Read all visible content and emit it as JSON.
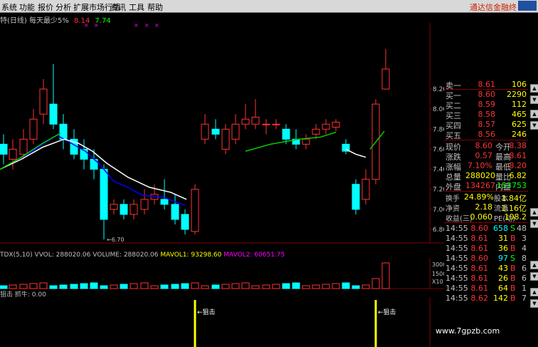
{
  "menu": {
    "items": [
      "系统",
      "功能",
      "报价",
      "分析",
      "扩展市场行情",
      "资讯",
      "工具",
      "帮助"
    ],
    "brand": "通达信金融终"
  },
  "chart": {
    "title_name": "特(日线) 每天最少5%",
    "title_v1": "8.14",
    "title_v2": "7.74",
    "price_ticks": [
      "8.20",
      "8.00",
      "7.80",
      "7.60",
      "7.40",
      "7.20",
      "7.00",
      "6.80"
    ],
    "low_label": "6.70",
    "volume_line": {
      "a": "TDX(5,10)",
      "b": "VVOL: 288020.06",
      "c": "VOLUME: 288020.06",
      "d": "MAVOL1: 93298.60",
      "e": "MAVOL2: 60651.75"
    },
    "volume_ticks": [
      "30000",
      "15000",
      "X10"
    ],
    "indicator_line": {
      "a": "狙击",
      "b": "抓牛: 0.00"
    },
    "signal_label": "狙击",
    "colors": {
      "up": "#ff3333",
      "down": "#00ffff",
      "ma_short": "#0000ff",
      "ma_long": "#ffffff",
      "ma_green": "#00cc00",
      "signal": "#ffff00"
    }
  },
  "quote": {
    "ask": [
      {
        "label": "卖一",
        "price": "8.61",
        "vol": "106"
      }
    ],
    "bid": [
      {
        "label": "买一",
        "price": "8.60",
        "vol": "2290"
      },
      {
        "label": "买二",
        "price": "8.59",
        "vol": "112"
      },
      {
        "label": "买三",
        "price": "8.58",
        "vol": "465"
      },
      {
        "label": "买四",
        "price": "8.57",
        "vol": "625"
      },
      {
        "label": "买五",
        "price": "8.56",
        "vol": "246"
      }
    ],
    "stats": [
      {
        "l1": "现价",
        "v1": "8.60",
        "l2": "今开",
        "v2": "8.38"
      },
      {
        "l1": "涨跌",
        "v1": "0.57",
        "l2": "最高",
        "v2": "8.61"
      },
      {
        "l1": "涨幅",
        "v1": "7.10%",
        "l2": "最低",
        "v2": "8.20"
      },
      {
        "l1": "总量",
        "v1": "288020",
        "l2": "量比",
        "v2": "6.82"
      },
      {
        "l1": "外盘",
        "v1": "134267",
        "l2": "内盘",
        "v2": "153753"
      }
    ],
    "stats2": [
      {
        "l1": "换手",
        "v1": "24.89%",
        "l2": "股本",
        "v2": "1.84亿"
      },
      {
        "l1": "净资",
        "v1": "2.18",
        "l2": "流通",
        "v2": "1.16亿"
      },
      {
        "l1": "收益(三)",
        "v1": "0.060",
        "l2": "PE(动)",
        "v2": "108.2"
      }
    ],
    "ticks": [
      {
        "time": "14:55",
        "price": "8.60",
        "vol": "658",
        "side": "S",
        "n": "48"
      },
      {
        "time": "14:55",
        "price": "8.61",
        "vol": "31",
        "side": "B",
        "n": "3"
      },
      {
        "time": "14:55",
        "price": "8.61",
        "vol": "36",
        "side": "B",
        "n": "4"
      },
      {
        "time": "14:55",
        "price": "8.60",
        "vol": "97",
        "side": "S",
        "n": "8"
      },
      {
        "time": "14:55",
        "price": "8.61",
        "vol": "43",
        "side": "B",
        "n": "6"
      },
      {
        "time": "14:55",
        "price": "8.61",
        "vol": "26",
        "side": "B",
        "n": "6"
      },
      {
        "time": "14:55",
        "price": "8.61",
        "vol": "64",
        "side": "B",
        "n": "1"
      },
      {
        "time": "14:55",
        "price": "8.62",
        "vol": "142",
        "side": "B",
        "n": "7"
      }
    ]
  },
  "watermark": "www.7gpzb.com"
}
